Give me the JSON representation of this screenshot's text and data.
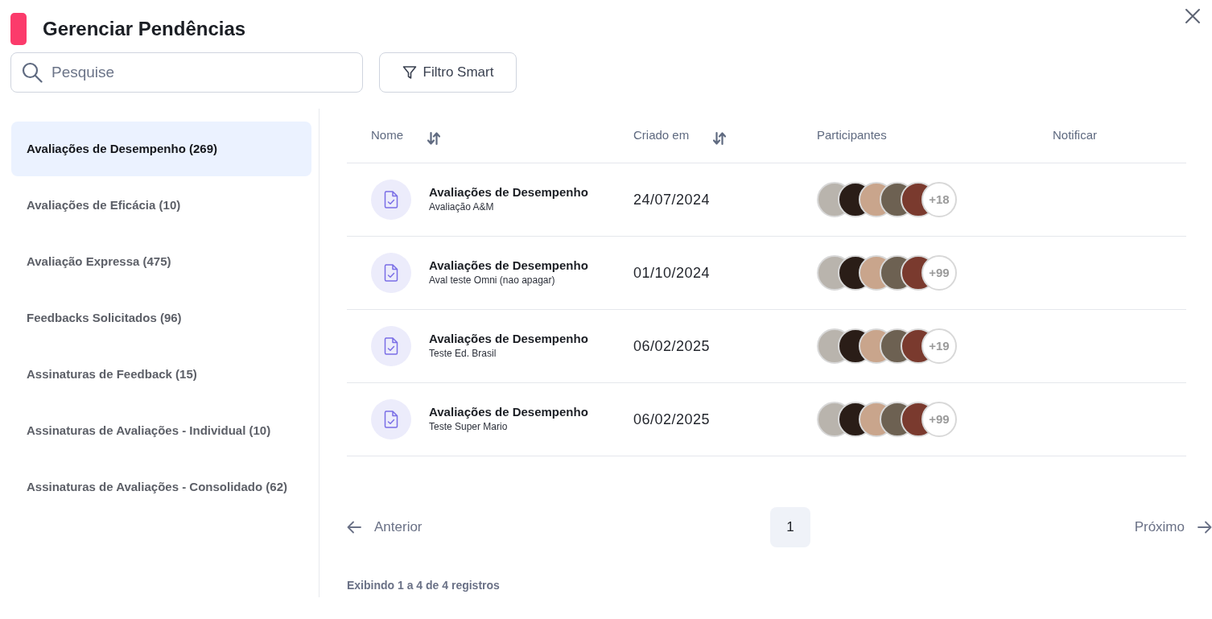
{
  "dialog": {
    "title": "Gerenciar Pendências"
  },
  "search": {
    "placeholder": "Pesquise"
  },
  "filter_button": {
    "label": "Filtro Smart"
  },
  "sidebar": {
    "items": [
      {
        "label": "Avaliações de Desempenho (269)",
        "selected": true
      },
      {
        "label": "Avaliações de Eficácia (10)",
        "selected": false
      },
      {
        "label": "Avaliação Expressa (475)",
        "selected": false
      },
      {
        "label": "Feedbacks Solicitados (96)",
        "selected": false
      },
      {
        "label": "Assinaturas de Feedback (15)",
        "selected": false
      },
      {
        "label": "Assinaturas de Avaliações - Individual (10)",
        "selected": false
      },
      {
        "label": "Assinaturas de Avaliações - Consolidado (62)",
        "selected": false
      }
    ]
  },
  "table": {
    "columns": [
      {
        "label": "Nome",
        "sortable": true
      },
      {
        "label": "Criado em",
        "sortable": true
      },
      {
        "label": "Participantes",
        "sortable": false
      },
      {
        "label": "Notificar",
        "sortable": false
      }
    ],
    "rows": [
      {
        "title": "Avaliações de Desempenho",
        "subtitle": "Avaliação A&M",
        "created": "24/07/2024",
        "more": "+18"
      },
      {
        "title": "Avaliações de Desempenho",
        "subtitle": "Aval teste Omni (nao apagar)",
        "created": "01/10/2024",
        "more": "+99"
      },
      {
        "title": "Avaliações de Desempenho",
        "subtitle": "Teste Ed. Brasil",
        "created": "06/02/2025",
        "more": "+19"
      },
      {
        "title": "Avaliações de Desempenho",
        "subtitle": "Teste Super Mario",
        "created": "06/02/2025",
        "more": "+99"
      }
    ]
  },
  "pagination": {
    "previous": "Anterior",
    "pages": [
      {
        "label": "1",
        "selected": true
      }
    ],
    "next": "Próximo"
  },
  "footer": "Exibindo 1 a 4 de 4 registros"
}
